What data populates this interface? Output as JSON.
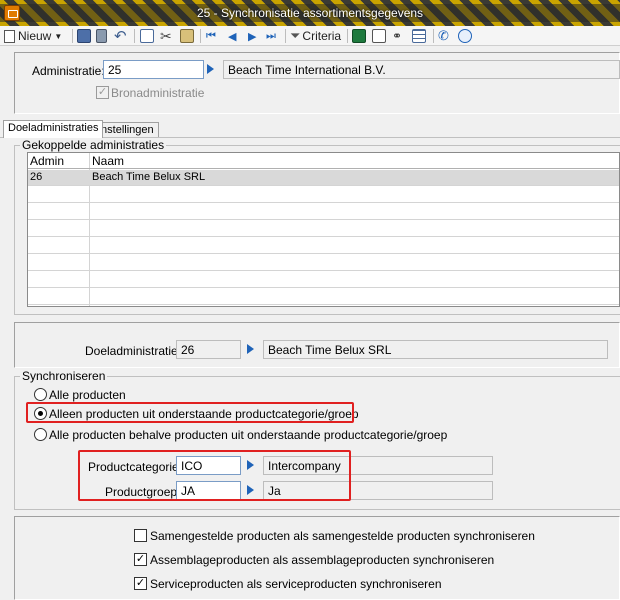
{
  "window": {
    "title": "25 - Synchronisatie assortimentsgegevens"
  },
  "toolbar": {
    "new_label": "Nieuw",
    "criteria_label": "Criteria"
  },
  "header": {
    "administratie_label": "Administratie:",
    "administratie_value": "25",
    "administratie_name": "Beach Time International B.V.",
    "bronadministratie_label": "Bronadministratie",
    "bronadministratie_checked": true
  },
  "tabs": [
    {
      "label": "Doeladministraties",
      "active": true
    },
    {
      "label": "Instellingen",
      "active": false
    }
  ],
  "linked": {
    "group_label": "Gekoppelde administraties",
    "columns": [
      "Admin",
      "Naam"
    ],
    "rows": [
      {
        "admin": "26",
        "naam": "Beach Time Belux SRL"
      }
    ]
  },
  "target": {
    "label": "Doeladministratie:",
    "value": "26",
    "name": "Beach Time Belux SRL"
  },
  "sync": {
    "group_label": "Synchroniseren",
    "options": [
      {
        "label": "Alle producten",
        "selected": false
      },
      {
        "label": "Alleen producten uit onderstaande productcategorie/groep",
        "selected": true
      },
      {
        "label": "Alle producten behalve producten uit onderstaande productcategorie/groep",
        "selected": false
      }
    ],
    "categorie_label": "Productcategorie:",
    "categorie_value": "ICO",
    "categorie_name": "Intercompany",
    "groep_label": "Productgroep:",
    "groep_value": "JA",
    "groep_name": "Ja"
  },
  "options": [
    {
      "label": "Samengestelde producten als samengestelde producten synchroniseren",
      "checked": false
    },
    {
      "label": "Assemblageproducten als assemblageproducten synchroniseren",
      "checked": true
    },
    {
      "label": "Serviceproducten als serviceproducten synchroniseren",
      "checked": true
    }
  ],
  "colors": {
    "accent_blue": "#1f63b8",
    "highlight_red": "#e02020",
    "title_stripe": "#c9a400"
  }
}
